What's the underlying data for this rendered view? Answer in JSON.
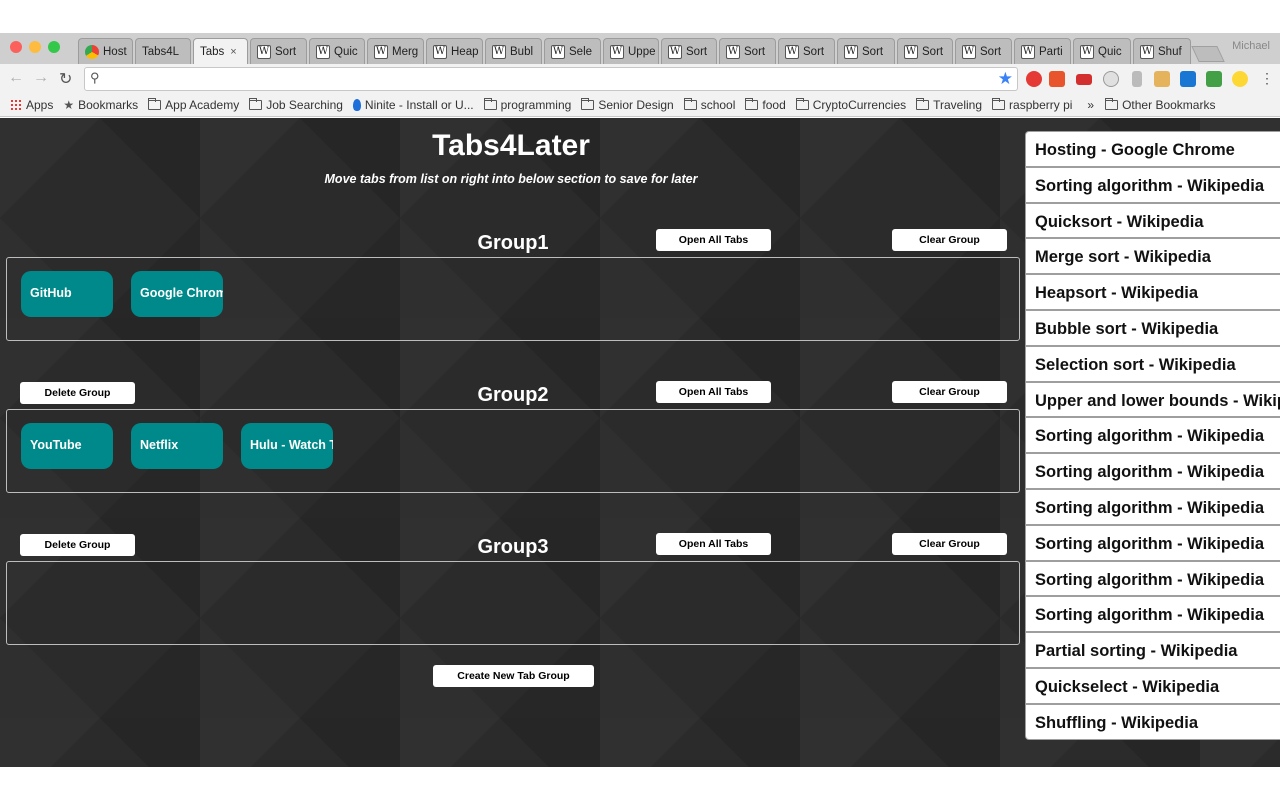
{
  "browser": {
    "tabs": [
      {
        "label": "Host",
        "icon": "chrome-icon"
      },
      {
        "label": "Tabs4L",
        "icon": "none"
      },
      {
        "label": "Tabs",
        "icon": "none",
        "active": true
      },
      {
        "label": "Sort",
        "icon": "W"
      },
      {
        "label": "Quic",
        "icon": "W"
      },
      {
        "label": "Merg",
        "icon": "W"
      },
      {
        "label": "Heap",
        "icon": "W"
      },
      {
        "label": "Bubl",
        "icon": "W"
      },
      {
        "label": "Sele",
        "icon": "W"
      },
      {
        "label": "Uppe",
        "icon": "W"
      },
      {
        "label": "Sort",
        "icon": "W"
      },
      {
        "label": "Sort",
        "icon": "W"
      },
      {
        "label": "Sort",
        "icon": "W"
      },
      {
        "label": "Sort",
        "icon": "W"
      },
      {
        "label": "Sort",
        "icon": "W"
      },
      {
        "label": "Sort",
        "icon": "W"
      },
      {
        "label": "Parti",
        "icon": "W"
      },
      {
        "label": "Quic",
        "icon": "W"
      },
      {
        "label": "Shuf",
        "icon": "W"
      }
    ],
    "profile_name": "Michael",
    "omnibox_value": "",
    "bookmarks": [
      {
        "label": "Apps",
        "icon": "apps-icon"
      },
      {
        "label": "Bookmarks",
        "icon": "star-icon"
      },
      {
        "label": "App Academy",
        "icon": "folder-icon"
      },
      {
        "label": "Job Searching",
        "icon": "folder-icon"
      },
      {
        "label": "Ninite - Install or U...",
        "icon": "ninite-icon"
      },
      {
        "label": "programming",
        "icon": "folder-icon"
      },
      {
        "label": "Senior Design",
        "icon": "folder-icon"
      },
      {
        "label": "school",
        "icon": "folder-icon"
      },
      {
        "label": "food",
        "icon": "folder-icon"
      },
      {
        "label": "CryptoCurrencies",
        "icon": "folder-icon"
      },
      {
        "label": "Traveling",
        "icon": "folder-icon"
      },
      {
        "label": "raspberry pi",
        "icon": "folder-icon"
      }
    ],
    "bookmarks_more": "»",
    "other_bookmarks": "Other Bookmarks"
  },
  "app": {
    "title": "Tabs4Later",
    "subtitle": "Move tabs from list on right into below section to save for later",
    "open_all_label": "Open All Tabs",
    "clear_label": "Clear Group",
    "delete_label": "Delete Group",
    "create_label": "Create New Tab Group",
    "groups": [
      {
        "name": "Group1",
        "tabs": [
          "GitHub",
          "Google Chrome"
        ]
      },
      {
        "name": "Group2",
        "tabs": [
          "YouTube",
          "Netflix",
          "Hulu - Watch TV"
        ]
      },
      {
        "name": "Group3",
        "tabs": []
      }
    ]
  },
  "tab_list": [
    "Hosting - Google Chrome",
    "Sorting algorithm - Wikipedia",
    "Quicksort - Wikipedia",
    "Merge sort - Wikipedia",
    "Heapsort - Wikipedia",
    "Bubble sort - Wikipedia",
    "Selection sort - Wikipedia",
    "Upper and lower bounds - Wikipedia",
    "Sorting algorithm - Wikipedia",
    "Sorting algorithm - Wikipedia",
    "Sorting algorithm - Wikipedia",
    "Sorting algorithm - Wikipedia",
    "Sorting algorithm - Wikipedia",
    "Sorting algorithm - Wikipedia",
    "Partial sorting - Wikipedia",
    "Quickselect - Wikipedia",
    "Shuffling - Wikipedia"
  ],
  "colors": {
    "saved_tab": "#00898a",
    "page_background": "#2b2b2b"
  }
}
